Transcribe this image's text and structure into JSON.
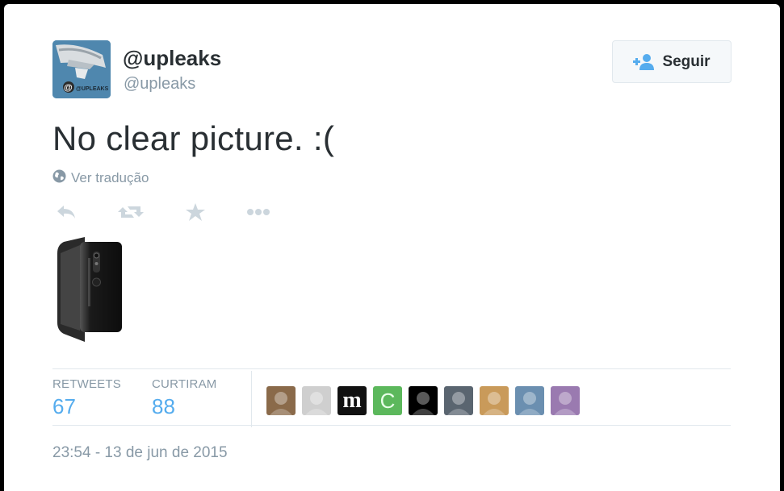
{
  "tweet": {
    "display_name": "@upleaks",
    "screen_name": "@upleaks",
    "avatar_icon": "upleaks-logo-avatar",
    "avatar_text": "@UPLEAKS",
    "text": "No clear picture. :(",
    "translate_label": "Ver tradução",
    "timestamp": "23:54 - 13 de jun de 2015"
  },
  "follow_button": {
    "label": "Seguir",
    "icon": "add-user-icon"
  },
  "actions": [
    {
      "icon": "reply-icon"
    },
    {
      "icon": "retweet-icon"
    },
    {
      "icon": "favorite-star-icon"
    },
    {
      "icon": "more-options-icon"
    }
  ],
  "media": {
    "icon": "black-smartphone-image"
  },
  "stats": {
    "retweets_label": "RETWEETS",
    "retweets_value": "67",
    "likes_label": "CURTIRAM",
    "likes_value": "88"
  },
  "likers": [
    {
      "name": "liker-avatar-1",
      "letter": "",
      "bg": "#8a6a4a"
    },
    {
      "name": "liker-avatar-2",
      "letter": "",
      "bg": "#cfcfcf"
    },
    {
      "name": "liker-avatar-3",
      "letter": "m",
      "bg": "#111111"
    },
    {
      "name": "liker-avatar-4",
      "letter": "C",
      "bg": "#5cb85c"
    },
    {
      "name": "liker-avatar-5",
      "letter": "",
      "bg": "#000000"
    },
    {
      "name": "liker-avatar-6",
      "letter": "",
      "bg": "#5a6570"
    },
    {
      "name": "liker-avatar-7",
      "letter": "",
      "bg": "#c99a5a"
    },
    {
      "name": "liker-avatar-8",
      "letter": "",
      "bg": "#6b8fb0"
    },
    {
      "name": "liker-avatar-9",
      "letter": "",
      "bg": "#9a7ab0"
    }
  ],
  "colors": {
    "text_primary": "#292f33",
    "text_muted": "#8899a6",
    "link_blue": "#55acee",
    "icon_gray": "#ccd6dd",
    "follow_icon_blue": "#55acee"
  }
}
